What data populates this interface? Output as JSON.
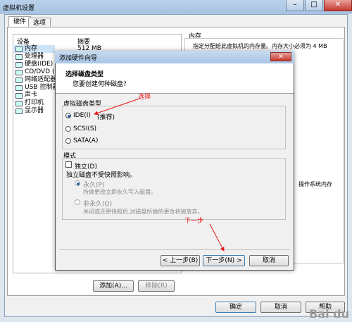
{
  "window": {
    "title": "虚拟机设置"
  },
  "tabs": [
    {
      "label": "硬件"
    },
    {
      "label": "选项"
    }
  ],
  "device_list": {
    "col_device": "设备",
    "col_summary": "摘要",
    "memory_summary": "512 MB",
    "items": [
      {
        "label": "内存"
      },
      {
        "label": "处理器"
      },
      {
        "label": "硬盘(IDE)"
      },
      {
        "label": "CD/DVD ("
      },
      {
        "label": "网络适配器"
      },
      {
        "label": "USB 控制器"
      },
      {
        "label": "声卡"
      },
      {
        "label": "打印机"
      },
      {
        "label": "显示器"
      }
    ]
  },
  "right_panel": {
    "heading": "内存",
    "desc": "指定分配给此虚拟机的内存量。内存大小必须为 4 MB",
    "partial_text": "操作系统内存"
  },
  "list_buttons": {
    "add": "添加(A)...",
    "remove": "移除(R)"
  },
  "main_buttons": {
    "ok": "确定",
    "cancel": "取消",
    "help": "帮助"
  },
  "wizard": {
    "title": "添加硬件向导",
    "header_title": "选择磁盘类型",
    "header_sub": "您要创建何种磁盘?",
    "group_disk": "虚拟磁盘类型",
    "options": [
      {
        "label": "IDE(I)",
        "extra": "(推荐)",
        "selected": true
      },
      {
        "label": "SCSI(S)",
        "selected": false
      },
      {
        "label": "SATA(A)",
        "selected": false
      }
    ],
    "group_mode": "模式",
    "independent_label": "独立(D)",
    "independent_desc": "独立磁盘不受快照影响。",
    "persistent_label": "永久(P)",
    "persistent_desc": "所做更改立即永久写入磁盘。",
    "nonpersistent_label": "非永久(O)",
    "nonpersistent_desc": "关闭或还原快照后,对磁盘所做的更改将被放弃。",
    "btn_back": "< 上一步(B)",
    "btn_next": "下一步(N) >",
    "btn_cancel": "取消"
  },
  "annotations": {
    "select": "选择",
    "next": "下一步"
  },
  "watermark": "Bai du"
}
